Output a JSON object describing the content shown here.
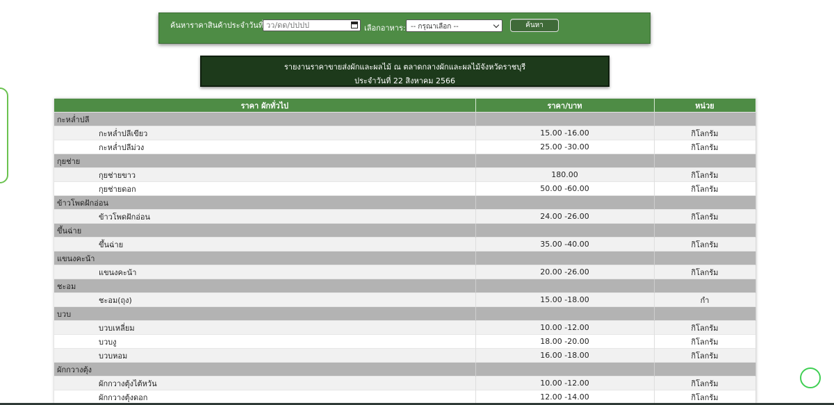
{
  "search": {
    "date_label": "ค้นหาราคาสินค้าประจำวันที่ :",
    "date_placeholder": "วว/ดด/ปปปป",
    "food_label": "เลือกอาหาร:",
    "food_select_value": "-- กรุณาเลือก --",
    "search_button": "ค้นหา"
  },
  "report": {
    "line1": "รายงานราคาขายส่งผักและผลไม้ ณ ตลาดกลางผักและผลไม้จังหวัดราชบุรี",
    "line2": "ประจำวันที่  22 สิงหาคม 2566"
  },
  "table": {
    "headers": [
      "ราคา ผักทั่วไป",
      "ราคา/บาท",
      "หน่วย"
    ],
    "rows": [
      {
        "type": "group",
        "name": "กะหล่ำปลี"
      },
      {
        "type": "item",
        "name": "กะหล่ำปลีเขียว",
        "price": "15.00 -16.00",
        "unit": "กิโลกรัม"
      },
      {
        "type": "item",
        "name": "กะหล่ำปลีม่วง",
        "price": "25.00 -30.00",
        "unit": "กิโลกรัม"
      },
      {
        "type": "group",
        "name": "กุยช่าย"
      },
      {
        "type": "item",
        "name": "กุยช่ายขาว",
        "price": "180.00",
        "unit": "กิโลกรัม"
      },
      {
        "type": "item",
        "name": "กุยช่ายดอก",
        "price": "50.00 -60.00",
        "unit": "กิโลกรัม"
      },
      {
        "type": "group",
        "name": "ข้าวโพดฝักอ่อน"
      },
      {
        "type": "item",
        "name": "ข้าวโพดฝักอ่อน",
        "price": "24.00 -26.00",
        "unit": "กิโลกรัม"
      },
      {
        "type": "group",
        "name": "ขึ้นฉ่าย"
      },
      {
        "type": "item",
        "name": "ขึ้นฉ่าย",
        "price": "35.00 -40.00",
        "unit": "กิโลกรัม"
      },
      {
        "type": "group",
        "name": "แขนงคะน้า"
      },
      {
        "type": "item",
        "name": "แขนงคะน้า",
        "price": "20.00 -26.00",
        "unit": "กิโลกรัม"
      },
      {
        "type": "group",
        "name": "ชะอม"
      },
      {
        "type": "item",
        "name": "ชะอม(ถุง)",
        "price": "15.00 -18.00",
        "unit": "กำ"
      },
      {
        "type": "group",
        "name": "บวบ"
      },
      {
        "type": "item",
        "name": "บวบเหลี่ยม",
        "price": "10.00 -12.00",
        "unit": "กิโลกรัม"
      },
      {
        "type": "item",
        "name": "บวบงู",
        "price": "18.00 -20.00",
        "unit": "กิโลกรัม"
      },
      {
        "type": "item",
        "name": "บวบหอม",
        "price": "16.00 -18.00",
        "unit": "กิโลกรัม"
      },
      {
        "type": "group",
        "name": "ผักกวางตุ้ง"
      },
      {
        "type": "item",
        "name": "ผักกวางตุ้งไต้หวัน",
        "price": "10.00 -12.00",
        "unit": "กิโลกรัม"
      },
      {
        "type": "item",
        "name": "ผักกวางตุ้งดอก",
        "price": "12.00 -14.00",
        "unit": "กิโลกรัม"
      }
    ]
  }
}
